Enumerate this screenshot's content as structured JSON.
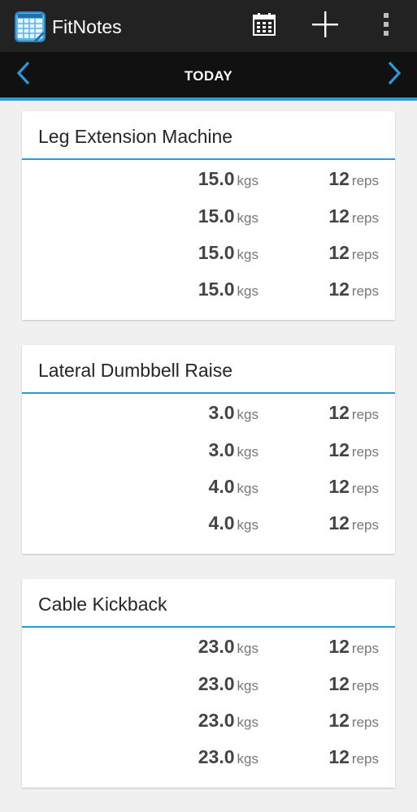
{
  "app": {
    "title": "FitNotes",
    "icon": "calendar-app-icon"
  },
  "toolbar": {
    "calendar_icon": "calendar-icon",
    "add_icon": "plus-icon",
    "more_icon": "overflow-menu-icon"
  },
  "date_nav": {
    "label": "TODAY",
    "prev_icon": "chevron-left-icon",
    "next_icon": "chevron-right-icon"
  },
  "colors": {
    "accent": "#2c9ad6",
    "actionbar": "#222222",
    "datebar": "#111111",
    "background": "#f0f0f0"
  },
  "exercises": [
    {
      "name": "Leg Extension Machine",
      "sets": [
        {
          "weight": "15.0",
          "weight_unit": "kgs",
          "reps": "12",
          "reps_unit": "reps"
        },
        {
          "weight": "15.0",
          "weight_unit": "kgs",
          "reps": "12",
          "reps_unit": "reps"
        },
        {
          "weight": "15.0",
          "weight_unit": "kgs",
          "reps": "12",
          "reps_unit": "reps"
        },
        {
          "weight": "15.0",
          "weight_unit": "kgs",
          "reps": "12",
          "reps_unit": "reps"
        }
      ]
    },
    {
      "name": "Lateral Dumbbell Raise",
      "sets": [
        {
          "weight": "3.0",
          "weight_unit": "kgs",
          "reps": "12",
          "reps_unit": "reps"
        },
        {
          "weight": "3.0",
          "weight_unit": "kgs",
          "reps": "12",
          "reps_unit": "reps"
        },
        {
          "weight": "4.0",
          "weight_unit": "kgs",
          "reps": "12",
          "reps_unit": "reps"
        },
        {
          "weight": "4.0",
          "weight_unit": "kgs",
          "reps": "12",
          "reps_unit": "reps"
        }
      ]
    },
    {
      "name": "Cable Kickback",
      "sets": [
        {
          "weight": "23.0",
          "weight_unit": "kgs",
          "reps": "12",
          "reps_unit": "reps"
        },
        {
          "weight": "23.0",
          "weight_unit": "kgs",
          "reps": "12",
          "reps_unit": "reps"
        },
        {
          "weight": "23.0",
          "weight_unit": "kgs",
          "reps": "12",
          "reps_unit": "reps"
        },
        {
          "weight": "23.0",
          "weight_unit": "kgs",
          "reps": "12",
          "reps_unit": "reps"
        }
      ]
    }
  ]
}
